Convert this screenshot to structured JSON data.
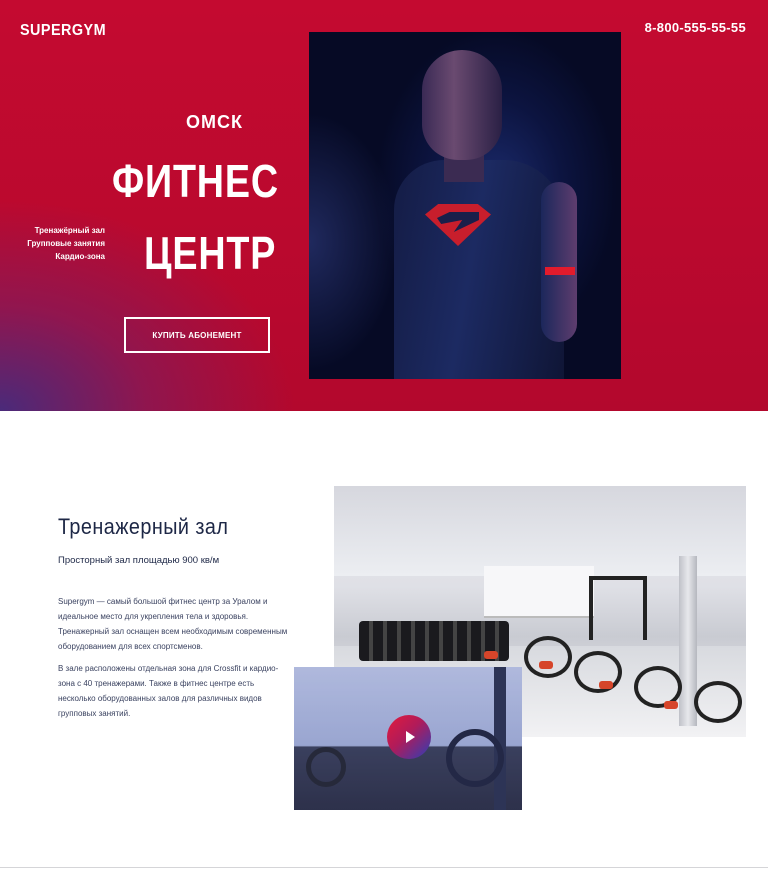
{
  "header": {
    "logo": "SUPERGYM",
    "phone": "8-800-555-55-55"
  },
  "hero": {
    "city": "ОМСК",
    "title_line1": "ФИТНЕС",
    "title_line2": "ЦЕНТР",
    "features": [
      "Тренажёрный зал",
      "Групповые занятия",
      "Кардио-зона"
    ],
    "cta_label": "КУПИТЬ АБОНЕМЕНТ"
  },
  "gym_section": {
    "title": "Тренажерный зал",
    "subtitle": "Просторный зал площадью 900 кв/м",
    "paragraph1": "Supergym — самый большой фитнес центр за Уралом и идеальное место для укрепления тела и здоровья. Тренажерный зал оснащен всем необходимым современным оборудованием для всех спортсменов.",
    "paragraph2": "В зале расположены отдельная зона для Crossfit и кардио-зона с 40 тренажерами. Также в фитнес центре есть несколько оборудованных залов для различных видов групповых занятий."
  },
  "colors": {
    "hero_red": "#c40a30",
    "hero_purple": "#4a2a7a",
    "heading_navy": "#1d2746"
  },
  "icons": {
    "play": "play-icon"
  }
}
